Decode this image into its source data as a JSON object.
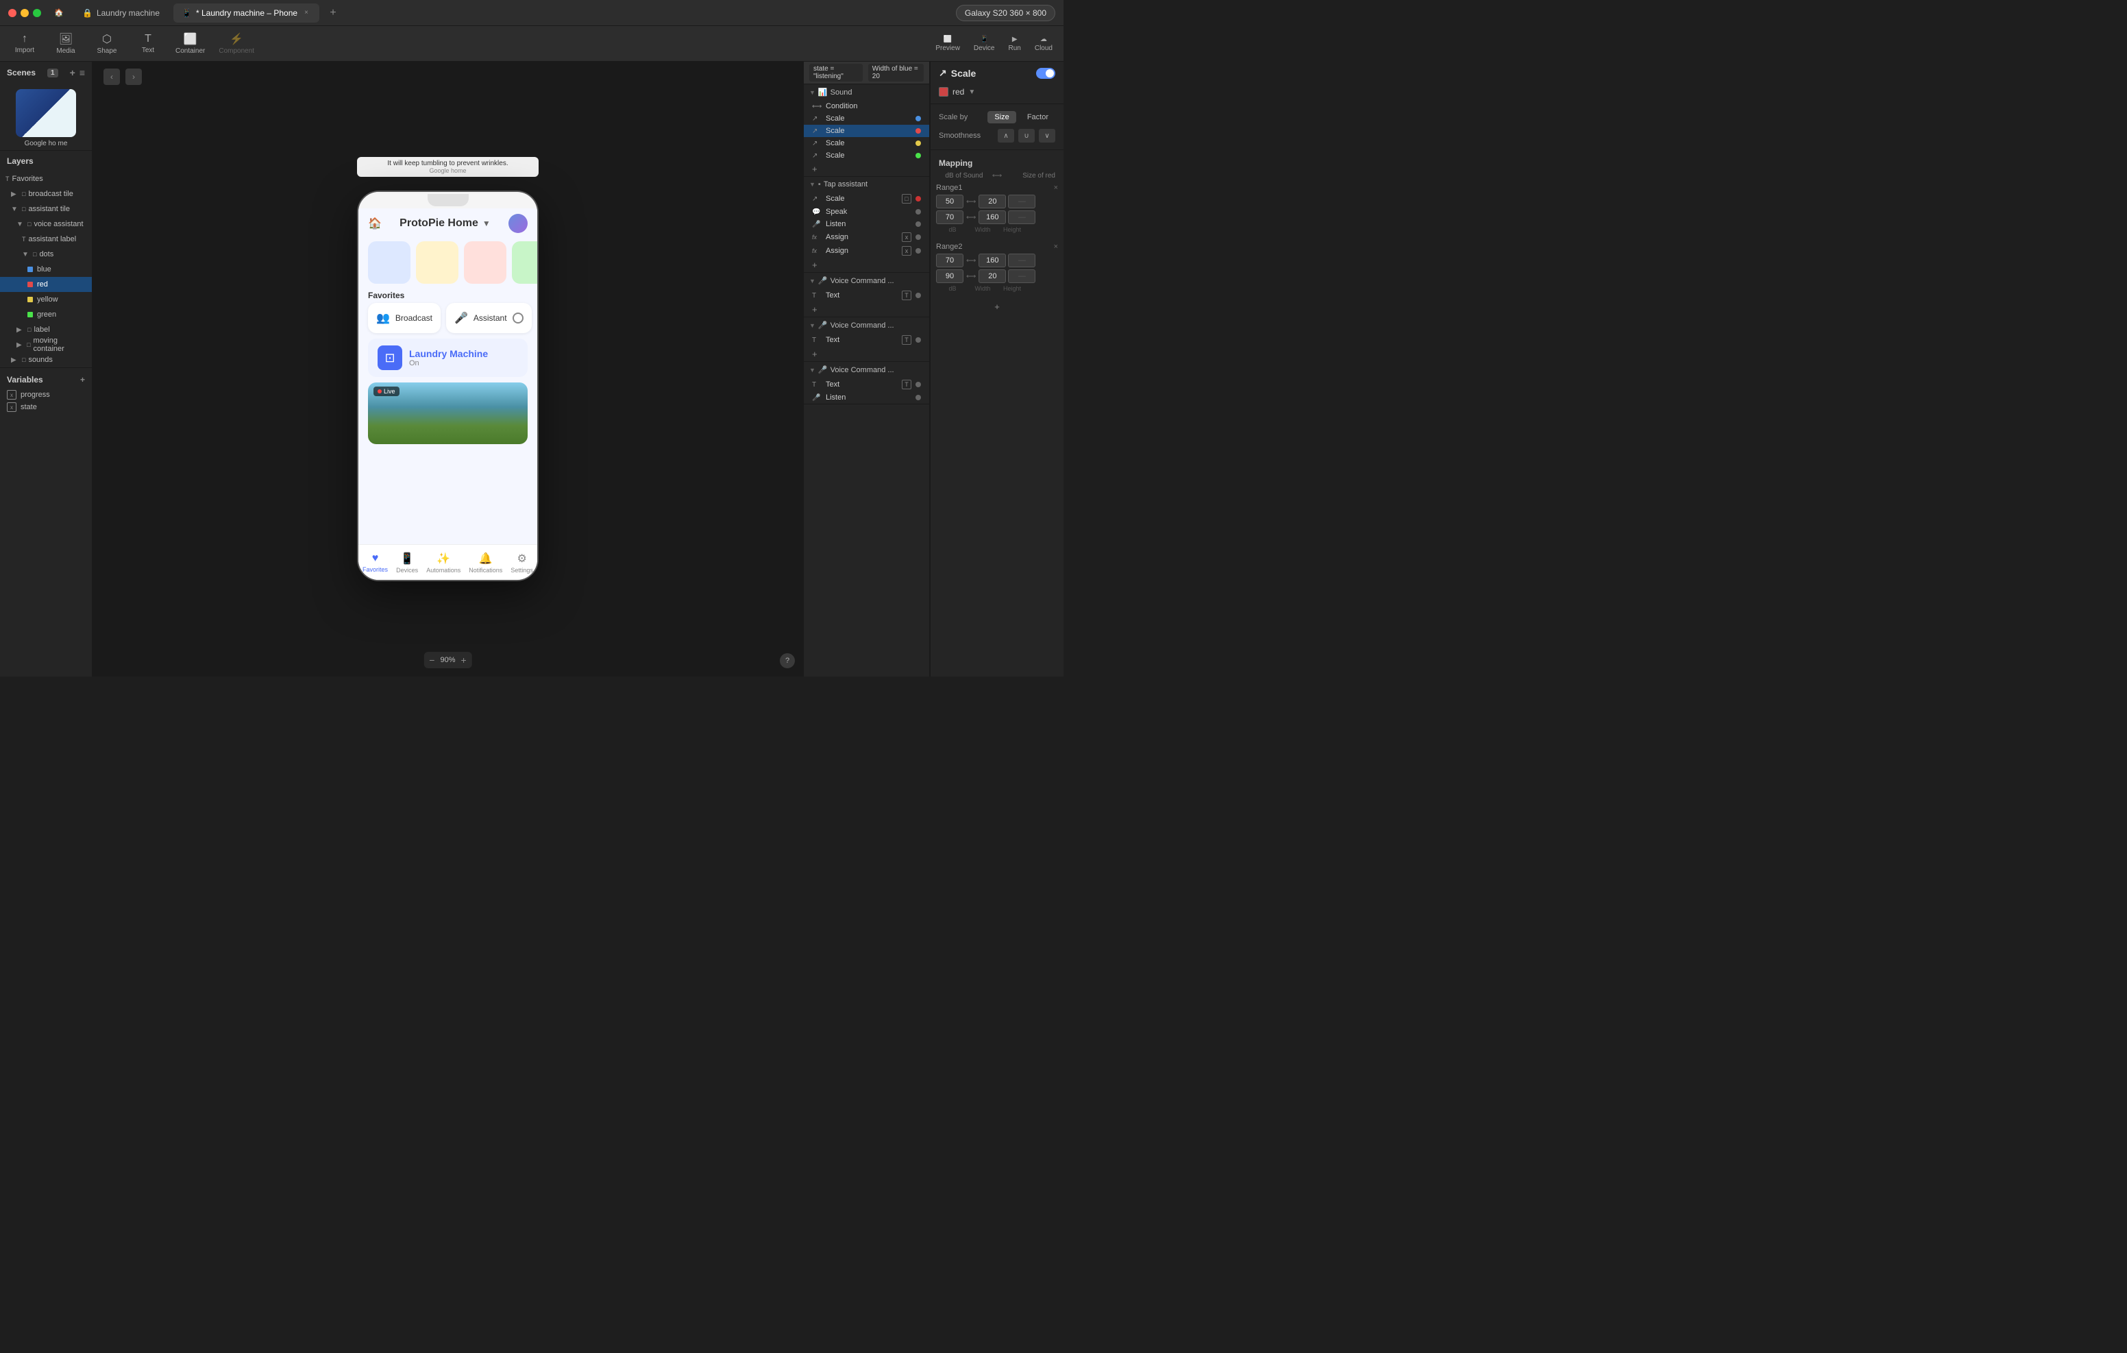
{
  "titlebar": {
    "tabs": [
      {
        "label": "Laundry machine",
        "icon": "🏠",
        "active": false
      },
      {
        "label": "* Laundry machine – Phone",
        "icon": "📱",
        "active": true
      }
    ],
    "new_tab_label": "+",
    "device_selector": "Galaxy S20  360 × 800"
  },
  "toolbar": {
    "items": [
      {
        "label": "Import",
        "icon": "↑"
      },
      {
        "label": "Media",
        "icon": "🖼"
      },
      {
        "label": "Shape",
        "icon": "⬡"
      },
      {
        "label": "Text",
        "icon": "T"
      },
      {
        "label": "Container",
        "icon": "⬜"
      },
      {
        "label": "Component",
        "icon": "⚡",
        "disabled": true
      }
    ],
    "right_items": [
      {
        "label": "Preview",
        "icon": "⬜"
      },
      {
        "label": "Device",
        "icon": "📱"
      },
      {
        "label": "Run",
        "icon": "▶"
      },
      {
        "label": "Cloud",
        "icon": "☁"
      }
    ]
  },
  "scenes": {
    "title": "Scenes",
    "count": "1",
    "items": [
      {
        "name": "Google ho me"
      }
    ]
  },
  "layers": {
    "title": "Layers",
    "items": [
      {
        "label": "Favorites",
        "type": "T",
        "indent": 0
      },
      {
        "label": "broadcast tile",
        "type": "□",
        "indent": 1
      },
      {
        "label": "assistant tile",
        "type": "□",
        "indent": 1,
        "expanded": true
      },
      {
        "label": "voice assistant",
        "type": "□",
        "indent": 2,
        "expanded": true
      },
      {
        "label": "assistant label",
        "type": "T",
        "indent": 3
      },
      {
        "label": "dots",
        "type": "□",
        "indent": 3,
        "expanded": true
      },
      {
        "label": "blue",
        "type": "■",
        "color": "#4a90e2",
        "indent": 4
      },
      {
        "label": "red",
        "type": "■",
        "color": "#e24a4a",
        "indent": 4,
        "selected": true
      },
      {
        "label": "yellow",
        "type": "■",
        "color": "#e2c94a",
        "indent": 4
      },
      {
        "label": "green",
        "type": "■",
        "color": "#4ae24a",
        "indent": 4
      },
      {
        "label": "label",
        "type": "□",
        "indent": 2
      },
      {
        "label": "moving container",
        "type": "□",
        "indent": 2
      },
      {
        "label": "sounds",
        "type": "□",
        "indent": 1
      }
    ]
  },
  "variables": {
    "title": "Variables",
    "items": [
      {
        "label": "progress"
      },
      {
        "label": "state"
      }
    ]
  },
  "phone": {
    "title": "ProtoPie Home",
    "tooltip": "It will keep tumbling to prevent wrinkles.",
    "tooltip_sub": "Google home",
    "tiles": [
      "blue",
      "yellow",
      "pink"
    ],
    "favorites_title": "Favorites",
    "fav_items": [
      {
        "icon": "👥",
        "label": "Broadcast"
      },
      {
        "icon": "🎤",
        "label": "Assistant"
      }
    ],
    "laundry_title": "Laundry Machine",
    "laundry_status": "On",
    "live_label": "Live",
    "nav_items": [
      {
        "icon": "♥",
        "label": "Favorites",
        "active": true
      },
      {
        "icon": "📱",
        "label": "Devices"
      },
      {
        "icon": "✨",
        "label": "Automations"
      },
      {
        "icon": "🔔",
        "label": "Notifications"
      },
      {
        "icon": "⚙",
        "label": "Settings"
      }
    ]
  },
  "zoom": {
    "level": "90%"
  },
  "interactions": {
    "groups": [
      {
        "title": "Sound",
        "icon": "📊",
        "rows": [
          {
            "label": "Condition",
            "icon": "⟷",
            "dot_color": null
          },
          {
            "label": "Scale",
            "icon": "↗",
            "dot_color": "#4a90e2",
            "selected": false
          },
          {
            "label": "Scale",
            "icon": "↗",
            "dot_color": "#e24a4a",
            "selected": true
          },
          {
            "label": "Scale",
            "icon": "↗",
            "dot_color": "#e2c94a",
            "selected": false
          },
          {
            "label": "Scale",
            "icon": "↗",
            "dot_color": "#4ae24a",
            "selected": false
          }
        ]
      },
      {
        "title": "Tap assistant",
        "icon": "👆",
        "rows": [
          {
            "label": "Scale",
            "icon": "↗",
            "dot_color": "#cc3333",
            "badge": "□"
          },
          {
            "label": "Speak",
            "icon": "💬",
            "dot_color": "#666"
          },
          {
            "label": "Listen",
            "icon": "🎤",
            "dot_color": "#666"
          },
          {
            "label": "Assign",
            "icon": "fx",
            "dot_color": "#666",
            "badge": "x"
          },
          {
            "label": "Assign",
            "icon": "fx",
            "dot_color": "#666",
            "badge": "x"
          }
        ]
      },
      {
        "title": "Voice Command ...",
        "icon": "🎤",
        "rows": [
          {
            "label": "Text",
            "icon": "T",
            "dot_color": "#666",
            "badge": "T"
          }
        ]
      },
      {
        "title": "Voice Command ...",
        "icon": "🎤",
        "rows": [
          {
            "label": "Text",
            "icon": "T",
            "dot_color": "#666",
            "badge": "T"
          }
        ]
      },
      {
        "title": "Voice Command ...",
        "icon": "🎤",
        "rows": [
          {
            "label": "Text",
            "icon": "T",
            "dot_color": "#666",
            "badge": "T"
          },
          {
            "label": "Listen",
            "icon": "🎤",
            "dot_color": "#666"
          }
        ]
      }
    ]
  },
  "condition": {
    "state_tag": "state = \"listening\"",
    "width_tag": "Width of blue = 20"
  },
  "right_panel": {
    "title": "Scale",
    "toggle_on": true,
    "color_label": "red",
    "scale_by": {
      "label": "Scale by",
      "options": [
        "Size",
        "Factor"
      ],
      "selected": "Size"
    },
    "smoothness_label": "Smoothness",
    "mapping_label": "Mapping",
    "mapping_cols": [
      "dB of Sound",
      "",
      "Size of red"
    ],
    "range1": {
      "label": "Range1",
      "rows": [
        {
          "db": "50",
          "width": "20",
          "height": null
        },
        {
          "db": "70",
          "width": "160",
          "height": null
        }
      ],
      "col_labels": [
        "dB",
        "Width",
        "Height"
      ]
    },
    "range2": {
      "label": "Range2",
      "rows": [
        {
          "db": "70",
          "width": "160",
          "height": null
        },
        {
          "db": "90",
          "width": "20",
          "height": null
        }
      ],
      "col_labels": [
        "dB",
        "Width",
        "Height"
      ]
    }
  }
}
